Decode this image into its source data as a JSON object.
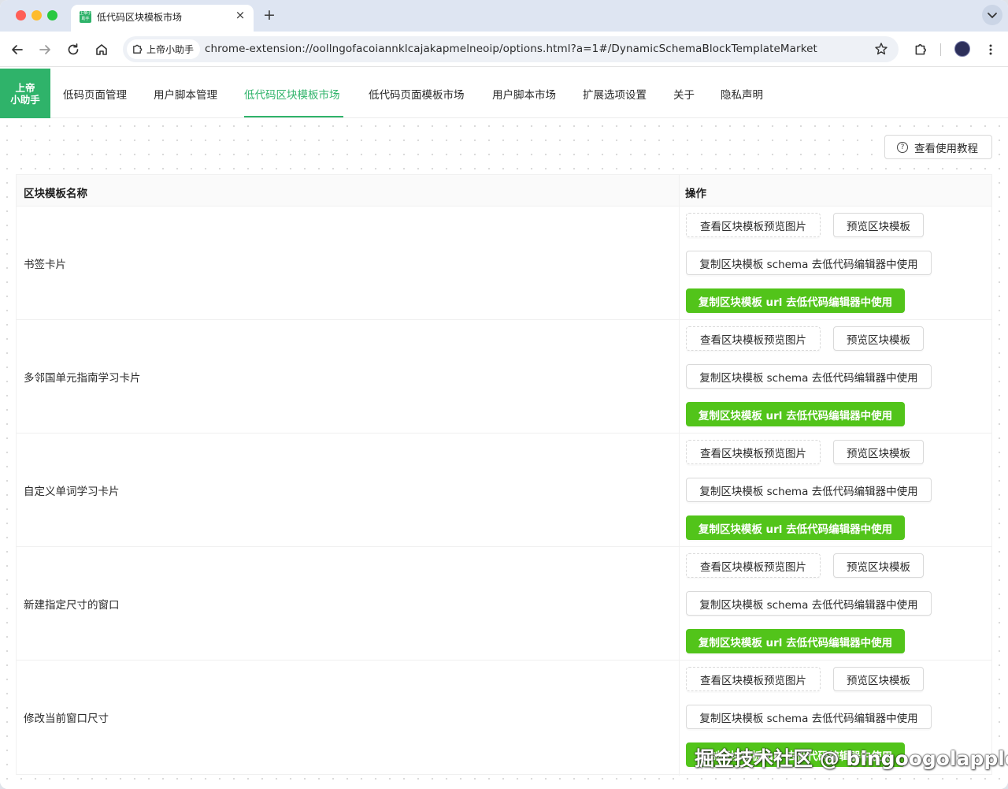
{
  "browser": {
    "tab_title": "低代码区块模板市场",
    "tab_icon": "app-favicon-icon",
    "url": "chrome-extension://oollngofacoiannklcajakapmelneoip/options.html?a=1#/DynamicSchemaBlockTemplateMarket",
    "extension_chip_label": "上帝小助手",
    "favicon_text": "上帝小助手"
  },
  "app": {
    "logo_line1": "上帝",
    "logo_line2": "小助手",
    "brand_color": "#2fb36a",
    "nav": [
      {
        "label": "低码页面管理"
      },
      {
        "label": "用户脚本管理"
      },
      {
        "label": "低代码区块模板市场"
      },
      {
        "label": "低代码页面模板市场"
      },
      {
        "label": "用户脚本市场"
      },
      {
        "label": "扩展选项设置"
      },
      {
        "label": "关于"
      },
      {
        "label": "隐私声明"
      }
    ],
    "active_nav": "低代码区块模板市场"
  },
  "help_button": {
    "label": "查看使用教程",
    "icon": "question-circle-icon"
  },
  "table": {
    "columns": [
      "区块模板名称",
      "操作"
    ],
    "action_labels": {
      "view_preview_image": "查看区块模板预览图片",
      "preview_block": "预览区块模板",
      "copy_schema": "复制区块模板 schema 去低代码编辑器中使用",
      "copy_url": "复制区块模板 url 去低代码编辑器中使用"
    },
    "primary_color": "#52c41a",
    "rows": [
      {
        "name": "书签卡片"
      },
      {
        "name": "多邻国单元指南学习卡片"
      },
      {
        "name": "自定义单词学习卡片"
      },
      {
        "name": "新建指定尺寸的窗口"
      },
      {
        "name": "修改当前窗口尺寸"
      }
    ]
  },
  "watermark": "掘金技术社区 @ bingoogolapple"
}
